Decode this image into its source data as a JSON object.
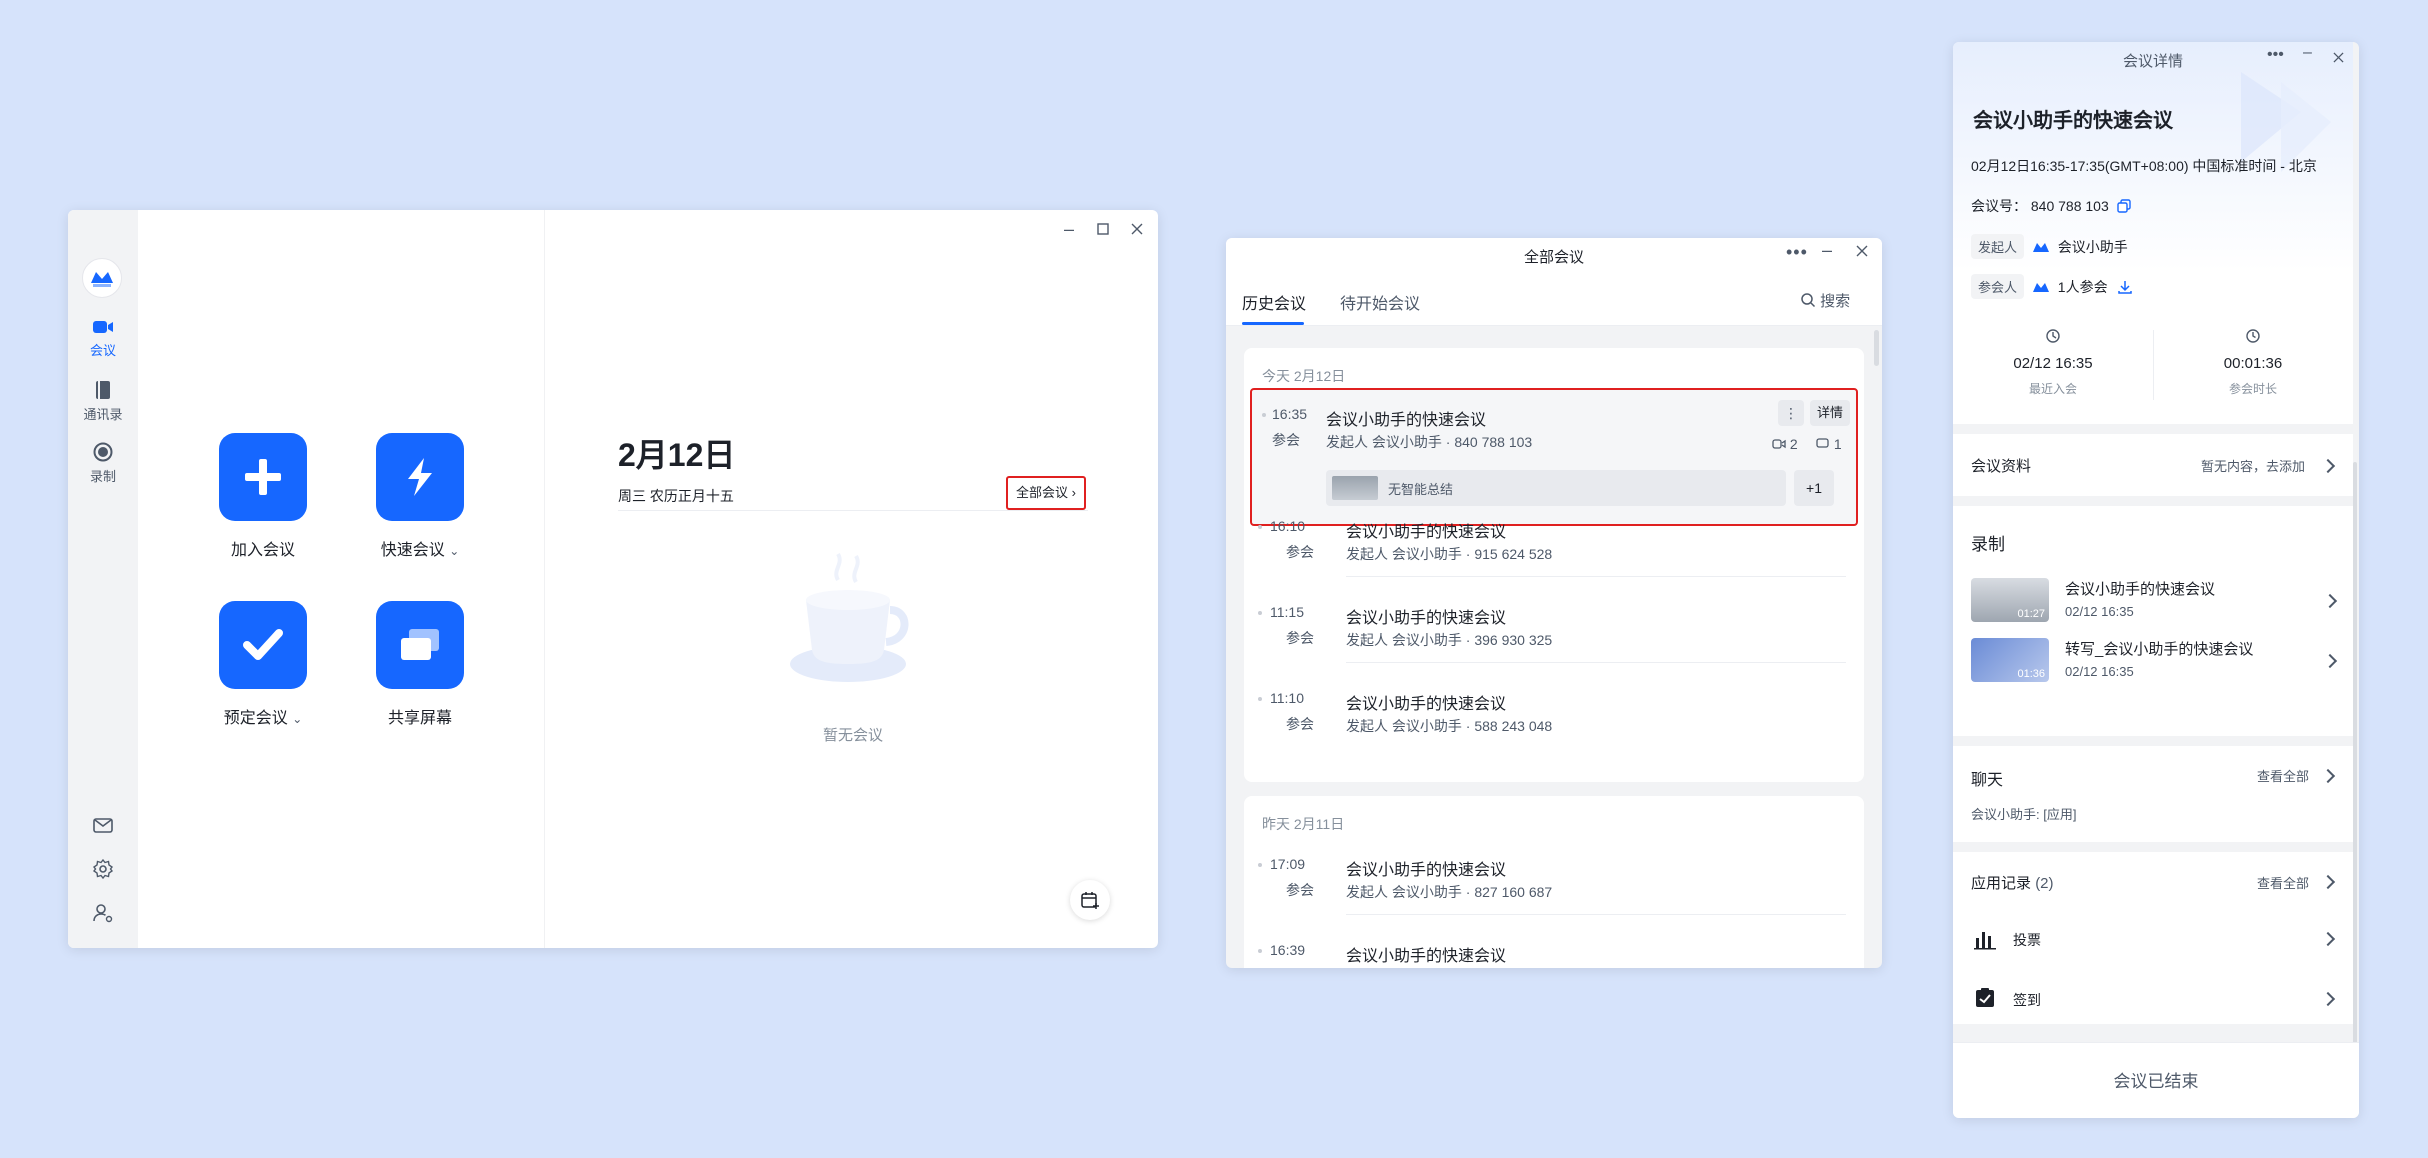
{
  "main_window": {
    "nav": [
      {
        "label": "会议",
        "icon": "video-camera-icon",
        "active": true
      },
      {
        "label": "通讯录",
        "icon": "contacts-book-icon",
        "active": false
      },
      {
        "label": "录制",
        "icon": "record-icon",
        "active": false
      }
    ],
    "bottom_icons": [
      "mail-icon",
      "gear-icon",
      "user-settings-icon"
    ],
    "actions": {
      "join": "加入会议",
      "quick": "快速会议",
      "schedule": "预定会议",
      "share": "共享屏幕"
    },
    "date": "2月12日",
    "lunar": "周三 农历正月十五",
    "all_meetings_link": "全部会议",
    "empty_text": "暂无会议",
    "accent": "#1667ff"
  },
  "all_window": {
    "title": "全部会议",
    "tabs": [
      "历史会议",
      "待开始会议"
    ],
    "search": "搜索",
    "groups": [
      {
        "day": "今天 2月12日",
        "items": [
          {
            "time": "16:35",
            "status": "参会",
            "title": "会议小助手的快速会议",
            "sub": "发起人 会议小助手 · 840 788 103",
            "video_count": "2",
            "chat_count": "1",
            "detail": "详情",
            "summary": "无智能总结",
            "plus": "+1"
          },
          {
            "time": "16:10",
            "status": "参会",
            "title": "会议小助手的快速会议",
            "sub": "发起人 会议小助手 · 915 624 528"
          },
          {
            "time": "11:15",
            "status": "参会",
            "title": "会议小助手的快速会议",
            "sub": "发起人 会议小助手 · 396 930 325"
          },
          {
            "time": "11:10",
            "status": "参会",
            "title": "会议小助手的快速会议",
            "sub": "发起人 会议小助手 · 588 243 048"
          }
        ]
      },
      {
        "day": "昨天 2月11日",
        "items": [
          {
            "time": "17:09",
            "status": "参会",
            "title": "会议小助手的快速会议",
            "sub": "发起人 会议小助手 · 827 160 687"
          },
          {
            "time": "16:39",
            "title": "会议小助手的快速会议"
          }
        ]
      }
    ]
  },
  "detail_window": {
    "title": "会议详情",
    "meeting_title": "会议小助手的快速会议",
    "time_range": "02月12日16:35-17:35(GMT+08:00) 中国标准时间 - 北京",
    "meeting_id_label": "会议号：",
    "meeting_id": "840 788 103",
    "host_tag": "发起人",
    "host_name": "会议小助手",
    "participants_tag": "参会人",
    "participants": "1人参会",
    "recent_join_value": "02/12 16:35",
    "recent_join_label": "最近入会",
    "duration_value": "00:01:36",
    "duration_label": "参会时长",
    "materials_label": "会议资料",
    "materials_action": "暂无内容，去添加",
    "recording_label": "录制",
    "recordings": [
      {
        "title": "会议小助手的快速会议",
        "date": "02/12 16:35",
        "duration": "01:27"
      },
      {
        "title": "转写_会议小助手的快速会议",
        "date": "02/12 16:35",
        "duration": "01:36"
      }
    ],
    "chat_label": "聊天",
    "chat_view_all": "查看全部",
    "chat_preview": "会议小助手: [应用]",
    "app_records_label": "应用记录",
    "app_records_count": "(2)",
    "app_view_all": "查看全部",
    "apps": [
      {
        "label": "投票",
        "icon": "bar-chart-icon"
      },
      {
        "label": "签到",
        "icon": "check-clipboard-icon"
      }
    ],
    "ended": "会议已结束"
  }
}
